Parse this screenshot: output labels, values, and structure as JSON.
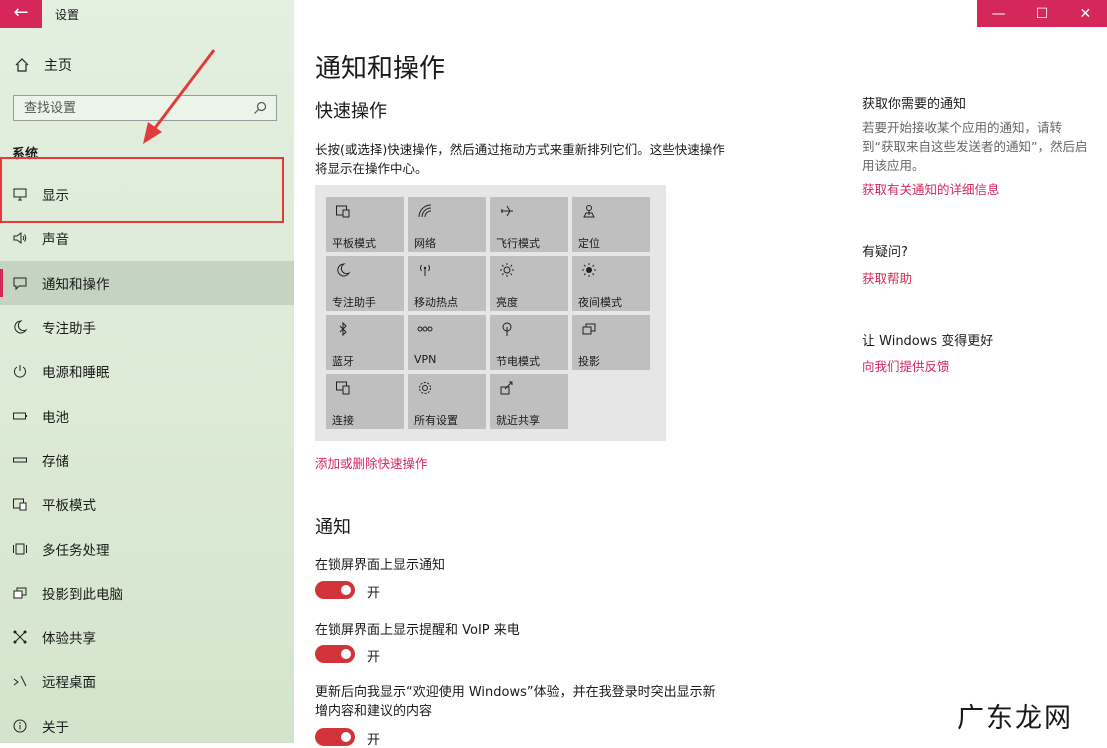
{
  "window": {
    "title": "设置",
    "back_icon": "arrow-left-icon"
  },
  "titlebar": {
    "minimize": "—",
    "maximize": "☐",
    "close": "✕"
  },
  "sidebar": {
    "home": "主页",
    "search_placeholder": "查找设置",
    "section": "系统",
    "items": [
      {
        "label": "显示",
        "icon": "monitor-icon"
      },
      {
        "label": "声音",
        "icon": "speaker-icon"
      },
      {
        "label": "通知和操作",
        "icon": "notification-icon",
        "active": true
      },
      {
        "label": "专注助手",
        "icon": "moon-icon"
      },
      {
        "label": "电源和睡眠",
        "icon": "power-icon"
      },
      {
        "label": "电池",
        "icon": "battery-icon"
      },
      {
        "label": "存储",
        "icon": "storage-icon"
      },
      {
        "label": "平板模式",
        "icon": "tablet-icon"
      },
      {
        "label": "多任务处理",
        "icon": "multitask-icon"
      },
      {
        "label": "投影到此电脑",
        "icon": "project-icon"
      },
      {
        "label": "体验共享",
        "icon": "share-icon"
      },
      {
        "label": "远程桌面",
        "icon": "remote-icon"
      },
      {
        "label": "关于",
        "icon": "info-icon"
      }
    ]
  },
  "main": {
    "title": "通知和操作",
    "quick_actions": {
      "heading": "快速操作",
      "description": "长按(或选择)快速操作，然后通过拖动方式来重新排列它们。这些快速操作将显示在操作中心。",
      "tiles": [
        "平板模式",
        "网络",
        "飞行模式",
        "定位",
        "专注助手",
        "移动热点",
        "亮度",
        "夜间模式",
        "蓝牙",
        "VPN",
        "节电模式",
        "投影",
        "连接",
        "所有设置",
        "就近共享"
      ],
      "add_remove_link": "添加或删除快速操作"
    },
    "notifications": {
      "heading": "通知",
      "toggles": [
        {
          "label": "在锁屏界面上显示通知",
          "state": "开",
          "on": true
        },
        {
          "label": "在锁屏界面上显示提醒和 VoIP 来电",
          "state": "开",
          "on": true
        },
        {
          "label": "更新后向我显示“欢迎使用 Windows”体验，并在我登录时突出显示新增内容和建议的内容",
          "state": "开",
          "on": true
        }
      ]
    }
  },
  "right": {
    "get_notif_heading": "获取你需要的通知",
    "get_notif_text": "若要开始接收某个应用的通知，请转到“获取来自这些发送者的通知”，然后启用该应用。",
    "get_notif_link": "获取有关通知的详细信息",
    "question_heading": "有疑问?",
    "help_link": "获取帮助",
    "improve_heading": "让 Windows 变得更好",
    "feedback_link": "向我们提供反馈"
  },
  "watermark": "广东龙网",
  "colors": {
    "accent": "#d6275a",
    "toggle_on": "#d13438",
    "annotation": "#e23b3b"
  }
}
